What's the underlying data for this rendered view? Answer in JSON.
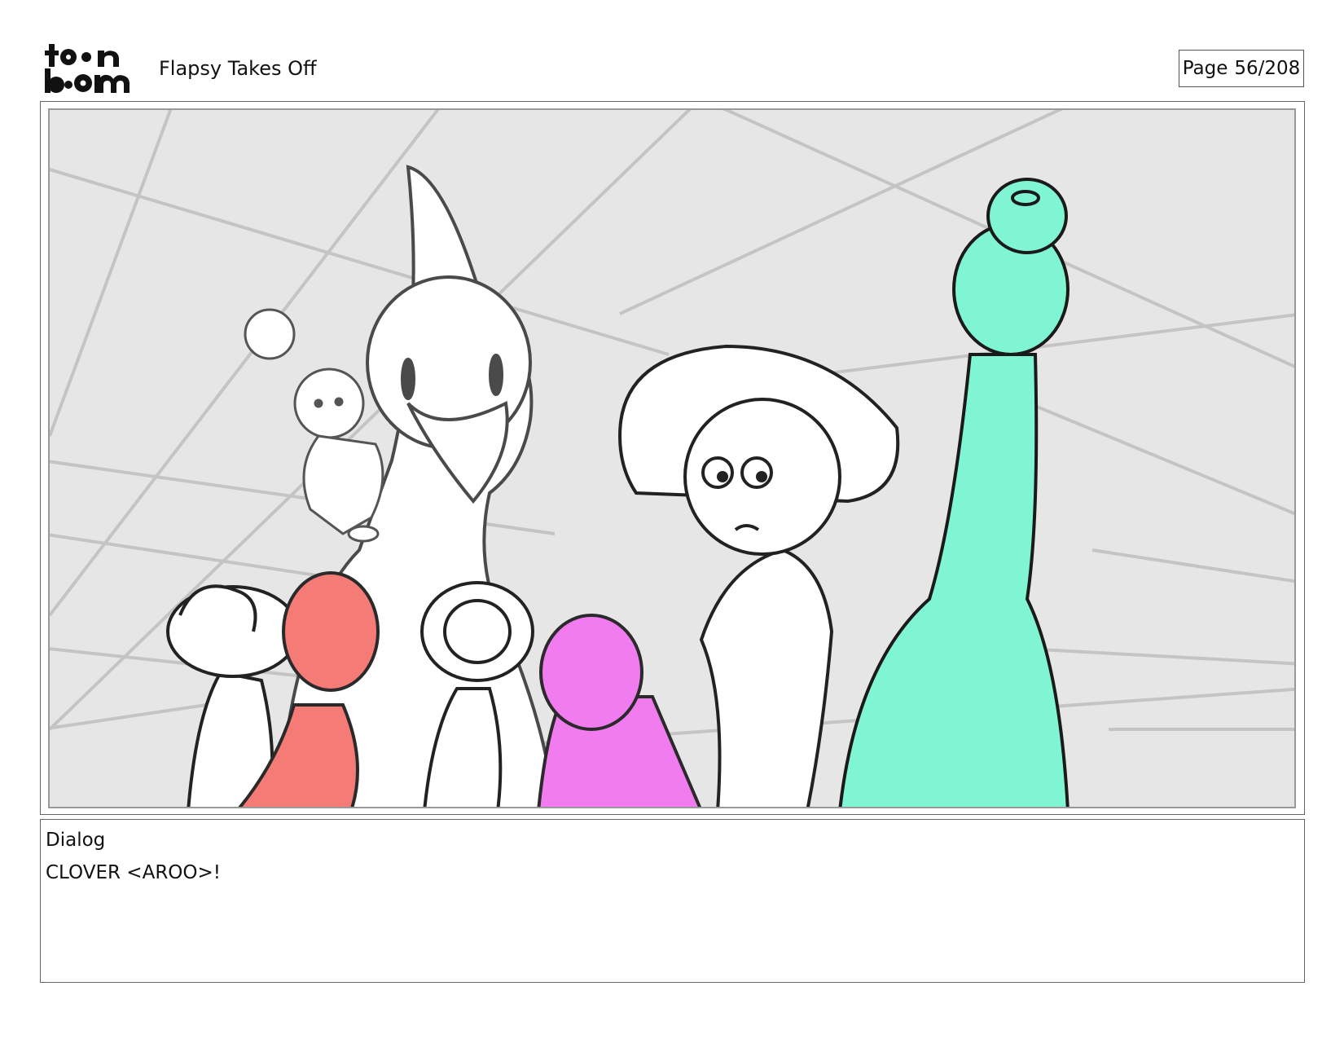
{
  "header": {
    "logo_text": "toon boom",
    "project_title": "Flapsy Takes Off",
    "page_label": "Page",
    "page_number": "56/208"
  },
  "panel": {
    "character_colors": {
      "red_character": "#f47b76",
      "magenta_character": "#f07cf0",
      "green_character": "#7ff5d4"
    },
    "background_color": "#e6e6e6"
  },
  "dialog": {
    "label": "Dialog",
    "text": "CLOVER <AROO>!"
  }
}
